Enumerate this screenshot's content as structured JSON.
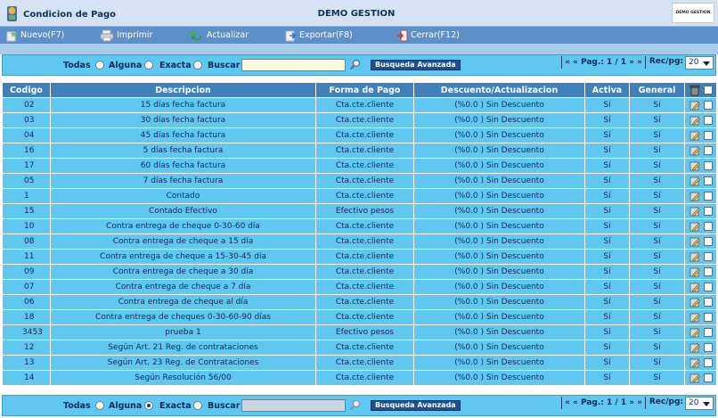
{
  "window": {
    "title": "Condicion de Pago",
    "center_title": "DEMO GESTION",
    "logo_text": "DEMO GESTION"
  },
  "toolbar": {
    "new_label": "Nuevo(F7)",
    "print_label": "Imprimir",
    "refresh_label": "Actualizar",
    "export_label": "Exportar(F8)",
    "close_label": "Cerrar(F12)"
  },
  "search_top": {
    "opt_all": "Todas",
    "opt_any": "Alguna",
    "opt_exact": "Exacta",
    "search_label": "Buscar",
    "search_value": "",
    "selected": "none",
    "advanced_label": "Busqueda Avanzada",
    "pager_text": "« « Pag.:  1 / 1 » »",
    "recpg_label": "Rec/pg:",
    "recpg_value": "20"
  },
  "search_bottom": {
    "opt_all": "Todas",
    "opt_any": "Alguna",
    "opt_exact": "Exacta",
    "search_label": "Buscar",
    "search_value": "",
    "selected": "Alguna",
    "advanced_label": "Busqueda Avanzada",
    "pager_text": "« « Pag.:  1 / 1 » »",
    "recpg_label": "Rec/pg:",
    "recpg_value": "20"
  },
  "table": {
    "headers": {
      "codigo": "Codigo",
      "descripcion": "Descripcion",
      "forma": "Forma de Pago",
      "descuento": "Descuento/Actualizacion",
      "activa": "Activa",
      "general": "General"
    },
    "rows": [
      {
        "codigo": "02",
        "descripcion": "15 días fecha factura",
        "forma": "Cta.cte.cliente",
        "descuento": "(%0.0 ) Sin Descuento",
        "activa": "Sí",
        "general": "Sí"
      },
      {
        "codigo": "03",
        "descripcion": "30 días fecha factura",
        "forma": "Cta.cte.cliente",
        "descuento": "(%0.0 ) Sin Descuento",
        "activa": "Sí",
        "general": "Sí"
      },
      {
        "codigo": "04",
        "descripcion": "45 días fecha factura",
        "forma": "Cta.cte.cliente",
        "descuento": "(%0.0 ) Sin Descuento",
        "activa": "Sí",
        "general": "Sí"
      },
      {
        "codigo": "16",
        "descripcion": "5 días fecha factura",
        "forma": "Cta.cte.cliente",
        "descuento": "(%0.0 ) Sin Descuento",
        "activa": "Sí",
        "general": "Sí"
      },
      {
        "codigo": "17",
        "descripcion": "60 días fecha factura",
        "forma": "Cta.cte.cliente",
        "descuento": "(%0.0 ) Sin Descuento",
        "activa": "Sí",
        "general": "Sí"
      },
      {
        "codigo": "05",
        "descripcion": "7 días fecha factura",
        "forma": "Cta.cte.cliente",
        "descuento": "(%0.0 ) Sin Descuento",
        "activa": "Sí",
        "general": "Sí"
      },
      {
        "codigo": "1",
        "descripcion": "Contado",
        "forma": "Cta.cte.cliente",
        "descuento": "(%0.0 ) Sin Descuento",
        "activa": "Sí",
        "general": "Sí"
      },
      {
        "codigo": "15",
        "descripcion": "Contado Efectivo",
        "forma": "Efectivo pesos",
        "descuento": "(%0.0 ) Sin Descuento",
        "activa": "Sí",
        "general": "Sí"
      },
      {
        "codigo": "10",
        "descripcion": "Contra entrega de cheque 0-30-60 día",
        "forma": "Cta.cte.cliente",
        "descuento": "(%0.0 ) Sin Descuento",
        "activa": "Sí",
        "general": "Sí"
      },
      {
        "codigo": "08",
        "descripcion": "Contra entrega de cheque a 15 día",
        "forma": "Cta.cte.cliente",
        "descuento": "(%0.0 ) Sin Descuento",
        "activa": "Sí",
        "general": "Sí"
      },
      {
        "codigo": "11",
        "descripcion": "Contra entrega de cheque a 15-30-45 día",
        "forma": "Cta.cte.cliente",
        "descuento": "(%0.0 ) Sin Descuento",
        "activa": "Sí",
        "general": "Sí"
      },
      {
        "codigo": "09",
        "descripcion": "Contra entrega de cheque a 30 día",
        "forma": "Cta.cte.cliente",
        "descuento": "(%0.0 ) Sin Descuento",
        "activa": "Sí",
        "general": "Sí"
      },
      {
        "codigo": "07",
        "descripcion": "Contra entrega de cheque a 7 día",
        "forma": "Cta.cte.cliente",
        "descuento": "(%0.0 ) Sin Descuento",
        "activa": "Sí",
        "general": "Sí"
      },
      {
        "codigo": "06",
        "descripcion": "Contra entrega de cheque al día",
        "forma": "Cta.cte.cliente",
        "descuento": "(%0.0 ) Sin Descuento",
        "activa": "Sí",
        "general": "Sí"
      },
      {
        "codigo": "18",
        "descripcion": "Contra entrega de cheques 0-30-60-90 días",
        "forma": "Cta.cte.cliente",
        "descuento": "(%0.0 ) Sin Descuento",
        "activa": "Sí",
        "general": "Sí"
      },
      {
        "codigo": "3453",
        "descripcion": "prueba 1",
        "forma": "Efectivo pesos",
        "descuento": "(%0.0 ) Sin Descuento",
        "activa": "Sí",
        "general": "Sí"
      },
      {
        "codigo": "12",
        "descripcion": "Según Art. 21 Reg. de contrataciones",
        "forma": "Cta.cte.cliente",
        "descuento": "(%0.0 ) Sin Descuento",
        "activa": "Sí",
        "general": "Sí"
      },
      {
        "codigo": "13",
        "descripcion": "Según Art. 23 Reg. de Contrataciones",
        "forma": "Cta.cte.cliente",
        "descuento": "(%0.0 ) Sin Descuento",
        "activa": "Sí",
        "general": "Sí"
      },
      {
        "codigo": "14",
        "descripcion": "Según Resolución 56/00",
        "forma": "Cta.cte.cliente",
        "descuento": "(%0.0 ) Sin Descuento",
        "activa": "Sí",
        "general": "Sí"
      }
    ]
  },
  "colors": {
    "toolbar": "#5d8fc9",
    "row": "#5fc7f0",
    "header": "#3f7fbc",
    "advanced_button": "#1e4f93"
  },
  "icons": {
    "new": "new-record-icon",
    "print": "printer-icon",
    "refresh": "refresh-icon",
    "export": "export-icon",
    "close": "exit-door-icon",
    "row_edit": "edit-icon",
    "header_delete": "trash-can-icon"
  }
}
